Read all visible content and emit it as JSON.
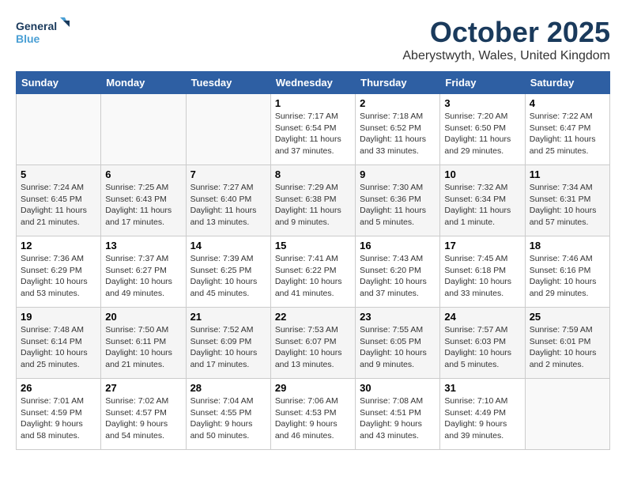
{
  "logo": {
    "line1": "General",
    "line2": "Blue"
  },
  "title": "October 2025",
  "subtitle": "Aberystwyth, Wales, United Kingdom",
  "weekdays": [
    "Sunday",
    "Monday",
    "Tuesday",
    "Wednesday",
    "Thursday",
    "Friday",
    "Saturday"
  ],
  "weeks": [
    [
      {
        "day": "",
        "sunrise": "",
        "sunset": "",
        "daylight": ""
      },
      {
        "day": "",
        "sunrise": "",
        "sunset": "",
        "daylight": ""
      },
      {
        "day": "",
        "sunrise": "",
        "sunset": "",
        "daylight": ""
      },
      {
        "day": "1",
        "sunrise": "Sunrise: 7:17 AM",
        "sunset": "Sunset: 6:54 PM",
        "daylight": "Daylight: 11 hours and 37 minutes."
      },
      {
        "day": "2",
        "sunrise": "Sunrise: 7:18 AM",
        "sunset": "Sunset: 6:52 PM",
        "daylight": "Daylight: 11 hours and 33 minutes."
      },
      {
        "day": "3",
        "sunrise": "Sunrise: 7:20 AM",
        "sunset": "Sunset: 6:50 PM",
        "daylight": "Daylight: 11 hours and 29 minutes."
      },
      {
        "day": "4",
        "sunrise": "Sunrise: 7:22 AM",
        "sunset": "Sunset: 6:47 PM",
        "daylight": "Daylight: 11 hours and 25 minutes."
      }
    ],
    [
      {
        "day": "5",
        "sunrise": "Sunrise: 7:24 AM",
        "sunset": "Sunset: 6:45 PM",
        "daylight": "Daylight: 11 hours and 21 minutes."
      },
      {
        "day": "6",
        "sunrise": "Sunrise: 7:25 AM",
        "sunset": "Sunset: 6:43 PM",
        "daylight": "Daylight: 11 hours and 17 minutes."
      },
      {
        "day": "7",
        "sunrise": "Sunrise: 7:27 AM",
        "sunset": "Sunset: 6:40 PM",
        "daylight": "Daylight: 11 hours and 13 minutes."
      },
      {
        "day": "8",
        "sunrise": "Sunrise: 7:29 AM",
        "sunset": "Sunset: 6:38 PM",
        "daylight": "Daylight: 11 hours and 9 minutes."
      },
      {
        "day": "9",
        "sunrise": "Sunrise: 7:30 AM",
        "sunset": "Sunset: 6:36 PM",
        "daylight": "Daylight: 11 hours and 5 minutes."
      },
      {
        "day": "10",
        "sunrise": "Sunrise: 7:32 AM",
        "sunset": "Sunset: 6:34 PM",
        "daylight": "Daylight: 11 hours and 1 minute."
      },
      {
        "day": "11",
        "sunrise": "Sunrise: 7:34 AM",
        "sunset": "Sunset: 6:31 PM",
        "daylight": "Daylight: 10 hours and 57 minutes."
      }
    ],
    [
      {
        "day": "12",
        "sunrise": "Sunrise: 7:36 AM",
        "sunset": "Sunset: 6:29 PM",
        "daylight": "Daylight: 10 hours and 53 minutes."
      },
      {
        "day": "13",
        "sunrise": "Sunrise: 7:37 AM",
        "sunset": "Sunset: 6:27 PM",
        "daylight": "Daylight: 10 hours and 49 minutes."
      },
      {
        "day": "14",
        "sunrise": "Sunrise: 7:39 AM",
        "sunset": "Sunset: 6:25 PM",
        "daylight": "Daylight: 10 hours and 45 minutes."
      },
      {
        "day": "15",
        "sunrise": "Sunrise: 7:41 AM",
        "sunset": "Sunset: 6:22 PM",
        "daylight": "Daylight: 10 hours and 41 minutes."
      },
      {
        "day": "16",
        "sunrise": "Sunrise: 7:43 AM",
        "sunset": "Sunset: 6:20 PM",
        "daylight": "Daylight: 10 hours and 37 minutes."
      },
      {
        "day": "17",
        "sunrise": "Sunrise: 7:45 AM",
        "sunset": "Sunset: 6:18 PM",
        "daylight": "Daylight: 10 hours and 33 minutes."
      },
      {
        "day": "18",
        "sunrise": "Sunrise: 7:46 AM",
        "sunset": "Sunset: 6:16 PM",
        "daylight": "Daylight: 10 hours and 29 minutes."
      }
    ],
    [
      {
        "day": "19",
        "sunrise": "Sunrise: 7:48 AM",
        "sunset": "Sunset: 6:14 PM",
        "daylight": "Daylight: 10 hours and 25 minutes."
      },
      {
        "day": "20",
        "sunrise": "Sunrise: 7:50 AM",
        "sunset": "Sunset: 6:11 PM",
        "daylight": "Daylight: 10 hours and 21 minutes."
      },
      {
        "day": "21",
        "sunrise": "Sunrise: 7:52 AM",
        "sunset": "Sunset: 6:09 PM",
        "daylight": "Daylight: 10 hours and 17 minutes."
      },
      {
        "day": "22",
        "sunrise": "Sunrise: 7:53 AM",
        "sunset": "Sunset: 6:07 PM",
        "daylight": "Daylight: 10 hours and 13 minutes."
      },
      {
        "day": "23",
        "sunrise": "Sunrise: 7:55 AM",
        "sunset": "Sunset: 6:05 PM",
        "daylight": "Daylight: 10 hours and 9 minutes."
      },
      {
        "day": "24",
        "sunrise": "Sunrise: 7:57 AM",
        "sunset": "Sunset: 6:03 PM",
        "daylight": "Daylight: 10 hours and 5 minutes."
      },
      {
        "day": "25",
        "sunrise": "Sunrise: 7:59 AM",
        "sunset": "Sunset: 6:01 PM",
        "daylight": "Daylight: 10 hours and 2 minutes."
      }
    ],
    [
      {
        "day": "26",
        "sunrise": "Sunrise: 7:01 AM",
        "sunset": "Sunset: 4:59 PM",
        "daylight": "Daylight: 9 hours and 58 minutes."
      },
      {
        "day": "27",
        "sunrise": "Sunrise: 7:02 AM",
        "sunset": "Sunset: 4:57 PM",
        "daylight": "Daylight: 9 hours and 54 minutes."
      },
      {
        "day": "28",
        "sunrise": "Sunrise: 7:04 AM",
        "sunset": "Sunset: 4:55 PM",
        "daylight": "Daylight: 9 hours and 50 minutes."
      },
      {
        "day": "29",
        "sunrise": "Sunrise: 7:06 AM",
        "sunset": "Sunset: 4:53 PM",
        "daylight": "Daylight: 9 hours and 46 minutes."
      },
      {
        "day": "30",
        "sunrise": "Sunrise: 7:08 AM",
        "sunset": "Sunset: 4:51 PM",
        "daylight": "Daylight: 9 hours and 43 minutes."
      },
      {
        "day": "31",
        "sunrise": "Sunrise: 7:10 AM",
        "sunset": "Sunset: 4:49 PM",
        "daylight": "Daylight: 9 hours and 39 minutes."
      },
      {
        "day": "",
        "sunrise": "",
        "sunset": "",
        "daylight": ""
      }
    ]
  ]
}
